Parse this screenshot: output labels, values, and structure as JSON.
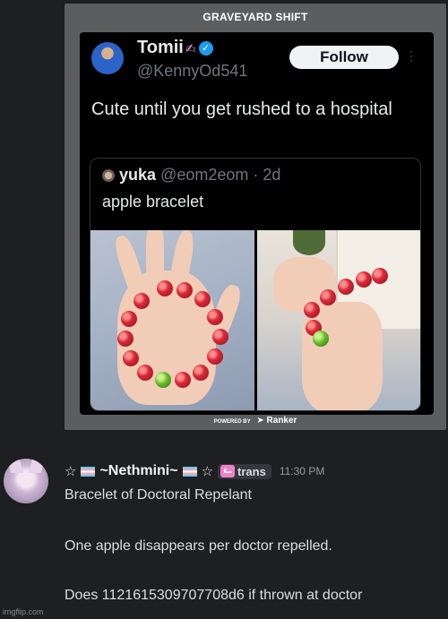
{
  "meme": {
    "brand": "GRAVEYARD SHIFT",
    "tweet": {
      "display_name": "Tomii",
      "name_emoji": "✍",
      "handle": "@KennyOd541",
      "follow_label": "Follow",
      "text": "Cute until you get rushed to a hospital",
      "quote": {
        "name": "yuka",
        "handle_time": "@eom2eom · 2d",
        "text": "apple bracelet"
      }
    },
    "footer_small": "POWERED BY",
    "footer": "Ranker"
  },
  "message": {
    "star": "☆",
    "username": "~Nethmini~",
    "role": "trans",
    "timestamp": "11:30 PM",
    "lines": [
      "Bracelet of Doctoral Repelant",
      "One apple disappears per doctor repelled.",
      "Does 1121615309707708d6 if thrown at doctor"
    ]
  },
  "watermark": "imgflip.com"
}
